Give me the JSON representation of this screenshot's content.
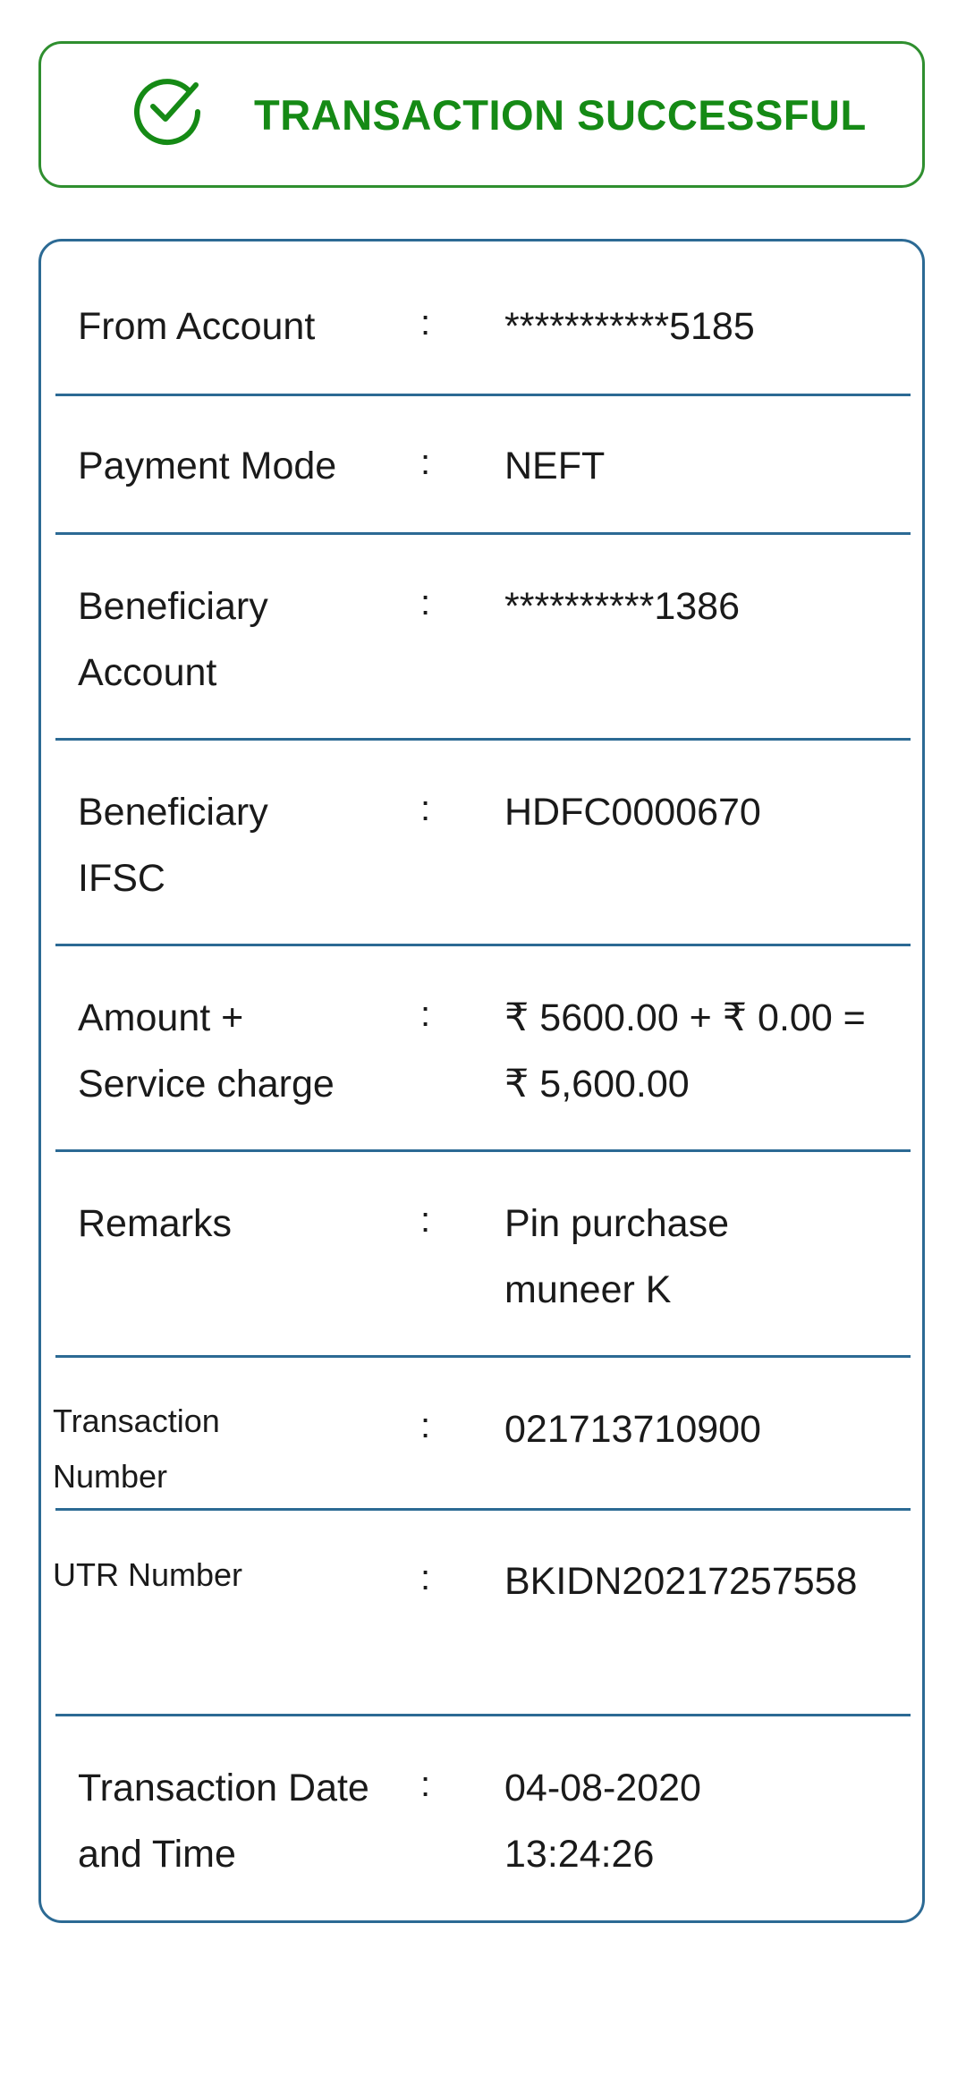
{
  "status": {
    "icon": "check-circle-icon",
    "text": "TRANSACTION SUCCESSFUL",
    "color": "#158a15"
  },
  "details": {
    "from_account": {
      "label": "From Account",
      "colon": ":",
      "value": "***********5185"
    },
    "payment_mode": {
      "label": "Payment Mode",
      "colon": ":",
      "value": "NEFT"
    },
    "beneficiary_account": {
      "label": "Beneficiary Account",
      "colon": ":",
      "value": "**********1386"
    },
    "beneficiary_ifsc": {
      "label": "Beneficiary IFSC",
      "colon": ":",
      "value": "HDFC0000670"
    },
    "amount": {
      "label": "Amount + Service charge",
      "colon": ":",
      "value": "₹ 5600.00 + ₹ 0.00 = ₹ 5,600.00"
    },
    "remarks": {
      "label": "Remarks",
      "colon": ":",
      "value": "Pin purchase muneer K"
    },
    "transaction_number": {
      "label": "Transaction Number",
      "colon": ":",
      "value": "021713710900"
    },
    "utr_number": {
      "label": "UTR Number",
      "colon": ":",
      "value": "BKIDN20217257558"
    },
    "transaction_datetime": {
      "label": "Transaction Date and Time",
      "colon": ":",
      "value": "04-08-2020 13:24:26"
    }
  },
  "colors": {
    "success_green": "#158a15",
    "card_border_blue": "#2c6a94"
  }
}
